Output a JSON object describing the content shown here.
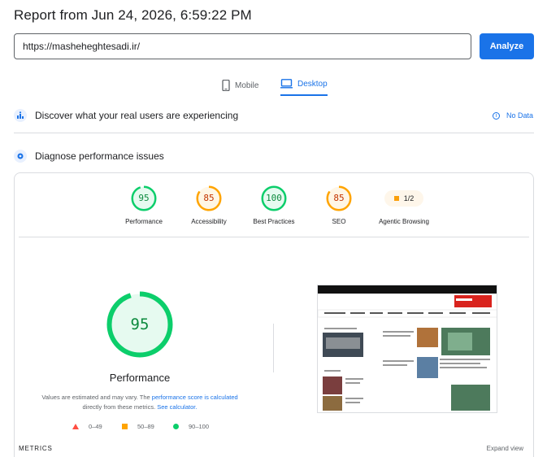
{
  "report": {
    "title": "Report from Jun 24, 2026, 6:59:22 PM"
  },
  "url_bar": {
    "value": "https://masheheghtesadi.ir/",
    "button_label": "Analyze"
  },
  "device_tabs": {
    "mobile": "Mobile",
    "desktop": "Desktop",
    "selected": "desktop"
  },
  "field_data": {
    "heading": "Discover what your real users are experiencing",
    "status": "No Data"
  },
  "diagnose": {
    "heading": "Diagnose performance issues"
  },
  "categories": [
    {
      "label": "Performance",
      "score": "95",
      "fraction": 0.95,
      "color": "#0cce6b",
      "text_color": "#0c8a3e"
    },
    {
      "label": "Accessibility",
      "score": "85",
      "fraction": 0.85,
      "color": "#ffa400",
      "text_color": "#c33300"
    },
    {
      "label": "Best Practices",
      "score": "100",
      "fraction": 1.0,
      "color": "#0cce6b",
      "text_color": "#0c8a3e"
    },
    {
      "label": "SEO",
      "score": "85",
      "fraction": 0.85,
      "color": "#ffa400",
      "text_color": "#c33300"
    },
    {
      "label": "Agentic Browsing",
      "score": "1/2"
    }
  ],
  "performance_detail": {
    "score": "95",
    "fraction": 0.95,
    "label": "Performance",
    "note_part1": "Values are estimated and may vary. The ",
    "note_link1": "performance score is calculated",
    "note_part2": " directly from these metrics. ",
    "note_link2": "See calculator."
  },
  "legend": [
    {
      "range": "0–49",
      "color": "#ff4e42",
      "shape": "triangle"
    },
    {
      "range": "50–89",
      "color": "#ffa400",
      "shape": "square"
    },
    {
      "range": "90–100",
      "color": "#0cce6b",
      "shape": "circle"
    }
  ],
  "metrics": {
    "heading": "METRICS",
    "expand_label": "Expand view"
  },
  "colors": {
    "accent": "#1a73e8",
    "pass": "#0cce6b",
    "average": "#ffa400",
    "fail": "#ff4e42"
  },
  "icons": [
    "mobile-icon",
    "desktop-icon",
    "users-icon",
    "diagnose-icon",
    "info-icon"
  ]
}
